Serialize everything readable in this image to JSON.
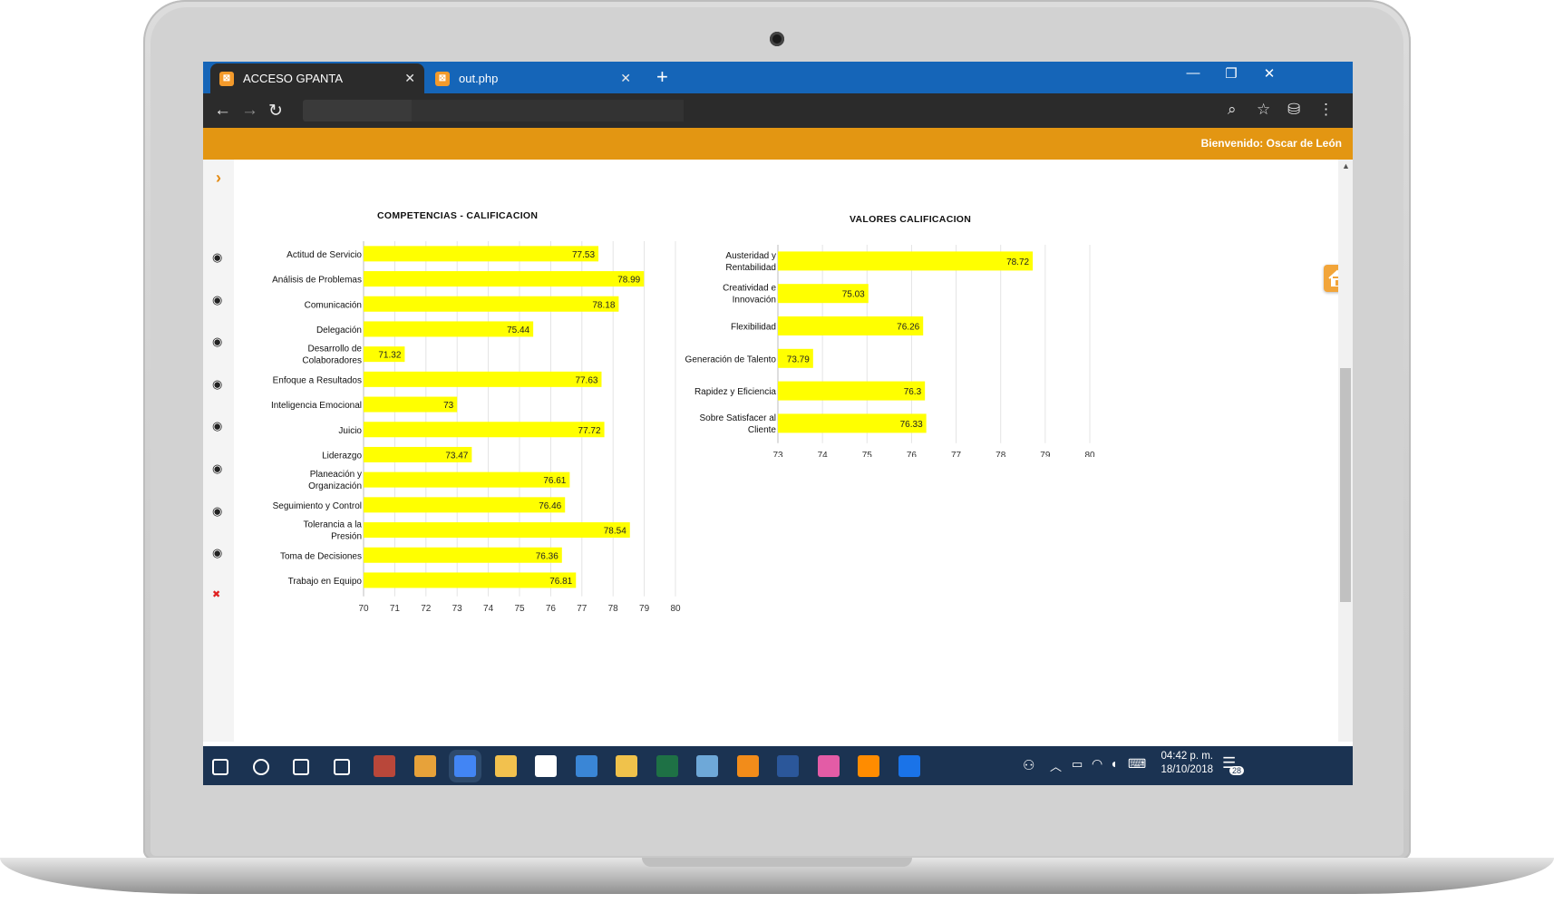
{
  "browser": {
    "tabs": [
      {
        "label": "ACCESO GPANTA",
        "active": true
      },
      {
        "label": "out.php",
        "active": false
      }
    ],
    "new_tab": "+",
    "window_controls": {
      "minimize": "—",
      "restore": "❐",
      "close": "✕"
    }
  },
  "header": {
    "welcome": "Bienvenido: Oscar de León"
  },
  "sidebar": {
    "icons": [
      "eye-icon",
      "eye-icon",
      "eye-icon",
      "eye-icon",
      "eye-icon",
      "eye-icon",
      "eye-icon",
      "eye-icon",
      "close-icon"
    ],
    "colors": {
      "eye": "#222222",
      "close": "#e02020"
    }
  },
  "charts": {
    "competencias": {
      "title": "COMPETENCIAS - CALIFICACION",
      "chart_data": {
        "type": "bar",
        "orientation": "horizontal",
        "categories": [
          [
            "Actitud de Servicio"
          ],
          [
            "Análisis de Problemas"
          ],
          [
            "Comunicación"
          ],
          [
            "Delegación"
          ],
          [
            "Desarrollo de",
            "Colaboradores"
          ],
          [
            "Enfoque a Resultados"
          ],
          [
            "Inteligencia Emocional"
          ],
          [
            "Juicio"
          ],
          [
            "Liderazgo"
          ],
          [
            "Planeación y",
            "Organización"
          ],
          [
            "Seguimiento y Control"
          ],
          [
            "Tolerancia a la",
            "Presión"
          ],
          [
            "Toma de Decisiones"
          ],
          [
            "Trabajo en Equipo"
          ]
        ],
        "values": [
          77.53,
          78.99,
          78.18,
          75.44,
          71.32,
          77.63,
          73,
          77.72,
          73.47,
          76.61,
          76.46,
          78.54,
          76.36,
          76.81
        ],
        "value_labels": [
          "77.53",
          "78.99",
          "78.18",
          "75.44",
          "71.32",
          "77.63",
          "73",
          "77.72",
          "73.47",
          "76.61",
          "76.46",
          "78.54",
          "76.36",
          "76.81"
        ],
        "xlim": [
          70,
          80
        ],
        "ticks": [
          "70",
          "71",
          "72",
          "73",
          "74",
          "75",
          "76",
          "77",
          "78",
          "79",
          "80"
        ],
        "bar_color": "#ffff00",
        "grid": true
      }
    },
    "valores": {
      "title": "VALORES CALIFICACION",
      "chart_data": {
        "type": "bar",
        "orientation": "horizontal",
        "categories": [
          [
            "Austeridad y",
            "Rentabilidad"
          ],
          [
            "Creatividad e",
            "Innovación"
          ],
          [
            "Flexibilidad"
          ],
          [
            "Generación de Talento"
          ],
          [
            "Rapidez y Eficiencia"
          ],
          [
            "Sobre Satisfacer al",
            "Cliente"
          ]
        ],
        "values": [
          78.72,
          75.03,
          76.26,
          73.79,
          76.3,
          76.33
        ],
        "value_labels": [
          "78.72",
          "75.03",
          "76.26",
          "73.79",
          "76.3",
          "76.33"
        ],
        "xlim": [
          73,
          80
        ],
        "ticks": [
          "73",
          "74",
          "75",
          "76",
          "77",
          "78",
          "79",
          "80"
        ],
        "bar_color": "#ffff00",
        "grid": true
      }
    }
  },
  "taskbar": {
    "apps": [
      "windows-start-icon",
      "cortana-icon",
      "task-view-icon",
      "connect-icon",
      "winrar-icon",
      "app-icon",
      "chrome-icon",
      "file-explorer-icon",
      "sticky-notes-icon",
      "dolphin-icon",
      "sql-icon",
      "excel-icon",
      "paint-icon",
      "sublime-icon",
      "word-icon",
      "itunes-icon",
      "media-player-icon",
      "app-blue-icon"
    ],
    "time": "04:42 p. m.",
    "date": "18/10/2018",
    "notifications": "28"
  }
}
